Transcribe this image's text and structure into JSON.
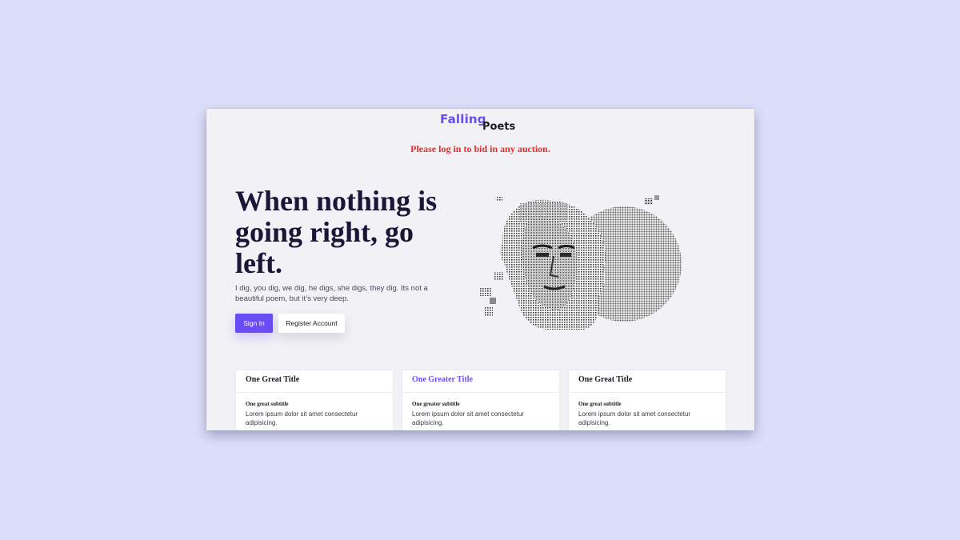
{
  "logo": {
    "part1": "Falling",
    "part2": "Poets"
  },
  "notice": "Please log in to bid in any auction.",
  "hero": {
    "title": "When nothing is going right, go left.",
    "text": "I dig, you dig, we dig, he digs, she digs, they dig. Its not a beautiful poem, but it’s very deep.",
    "art_icon": "halftone-buddha-head-illustration"
  },
  "buttons": {
    "sign_in": "Sign In",
    "register": "Register Account"
  },
  "cards": [
    {
      "title": "One Great Title",
      "subtitle": "One great subtitle",
      "text": "Lorem ipsum dolor sit amet consectetur adipisicing."
    },
    {
      "title": "One Greater Title",
      "subtitle": "One greater subtitle",
      "text": "Lorem ipsum dolor sit amet consectetur adipisicing."
    },
    {
      "title": "One Great Title",
      "subtitle": "One great subtitle",
      "text": "Lorem ipsum dolor sit amet consectetur adipisicing."
    }
  ],
  "colors": {
    "page_bg": "#dcdffa",
    "window_bg": "#f2f1f6",
    "accent": "#6a4cf5",
    "notice": "#e0302a",
    "heading": "#191638"
  }
}
